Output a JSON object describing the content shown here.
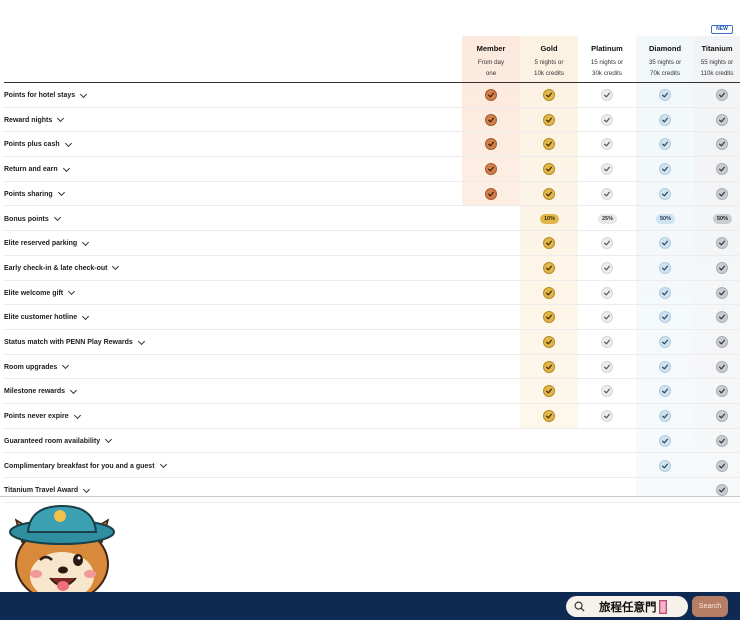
{
  "new_badge": "NEW",
  "tiers": [
    {
      "key": "member",
      "name": "Member",
      "requirement": "From day\none"
    },
    {
      "key": "gold",
      "name": "Gold",
      "requirement": "5 nights or\n10k credits"
    },
    {
      "key": "platinum",
      "name": "Platinum",
      "requirement": "15 nights or\n30k credits"
    },
    {
      "key": "diamond",
      "name": "Diamond",
      "requirement": "35 nights  or\n70k credits"
    },
    {
      "key": "titanium",
      "name": "Titanium",
      "requirement": "55 nights or\n110k credits"
    }
  ],
  "benefits": [
    {
      "label": "Points for hotel stays",
      "values": [
        "check",
        "check",
        "check",
        "check",
        "check"
      ]
    },
    {
      "label": "Reward nights",
      "values": [
        "check",
        "check",
        "check",
        "check",
        "check"
      ]
    },
    {
      "label": "Points plus cash",
      "values": [
        "check",
        "check",
        "check",
        "check",
        "check"
      ]
    },
    {
      "label": "Return and earn",
      "values": [
        "check",
        "check",
        "check",
        "check",
        "check"
      ]
    },
    {
      "label": "Points sharing",
      "values": [
        "check",
        "check",
        "check",
        "check",
        "check"
      ]
    },
    {
      "label": "Bonus points",
      "values": [
        "",
        "10%",
        "25%",
        "50%",
        "50%"
      ]
    },
    {
      "label": "Elite reserved parking",
      "values": [
        "",
        "check",
        "check",
        "check",
        "check"
      ]
    },
    {
      "label": "Early check-in & late check-out",
      "values": [
        "",
        "check",
        "check",
        "check",
        "check"
      ]
    },
    {
      "label": "Elite welcome gift",
      "values": [
        "",
        "check",
        "check",
        "check",
        "check"
      ]
    },
    {
      "label": "Elite customer hotline",
      "values": [
        "",
        "check",
        "check",
        "check",
        "check"
      ]
    },
    {
      "label": "Status match with PENN Play Rewards",
      "values": [
        "",
        "check",
        "check",
        "check",
        "check"
      ]
    },
    {
      "label": "Room upgrades",
      "values": [
        "",
        "check",
        "check",
        "check",
        "check"
      ]
    },
    {
      "label": "Milestone rewards",
      "values": [
        "",
        "check",
        "check",
        "check",
        "check"
      ]
    },
    {
      "label": "Points never expire",
      "values": [
        "",
        "check",
        "check",
        "check",
        "check"
      ]
    },
    {
      "label": "Guaranteed room availability",
      "values": [
        "",
        "",
        "",
        "check",
        "check"
      ]
    },
    {
      "label": "Complimentary breakfast for you and a guest",
      "values": [
        "",
        "",
        "",
        "check",
        "check"
      ]
    },
    {
      "label": "Titanium Travel Award",
      "values": [
        "",
        "",
        "",
        "",
        "check"
      ]
    }
  ],
  "footer": {
    "search_text": "旅程任意門",
    "search_button": "Search",
    "search_icon": "search-icon"
  },
  "colors": {
    "member": "#d0804a",
    "gold": "#e2b64a",
    "platinum": "#eceded",
    "diamond": "#cfe2f0",
    "titanium": "#c9ccd1",
    "footer_bg": "#0f2a52",
    "search_button_bg": "#b77e66"
  },
  "mascot": "shiba-dog-mascot-wearing-bucket-hat"
}
